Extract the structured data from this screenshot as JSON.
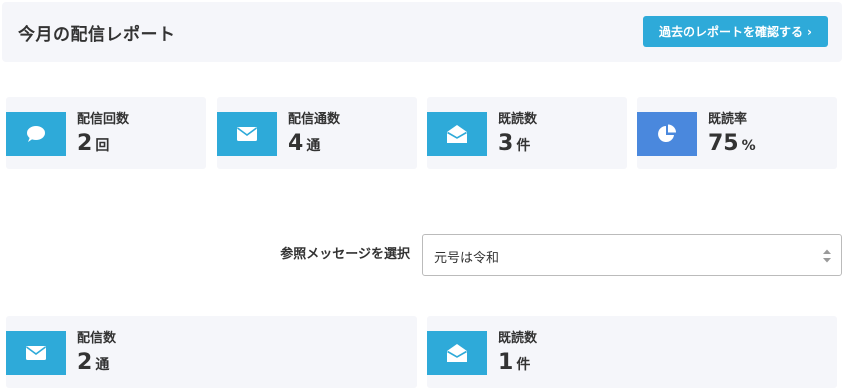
{
  "header": {
    "title": "今月の配信レポート",
    "button_label": "過去のレポートを確認する",
    "button_chevron": "›"
  },
  "stats": [
    {
      "label": "配信回数",
      "value": "2",
      "unit": "回",
      "icon": "chat-bubble-icon",
      "color": "#2eaad9"
    },
    {
      "label": "配信通数",
      "value": "4",
      "unit": "通",
      "icon": "envelope-icon",
      "color": "#2eaad9"
    },
    {
      "label": "既読数",
      "value": "3",
      "unit": "件",
      "icon": "envelope-open-icon",
      "color": "#2eaad9"
    },
    {
      "label": "既読率",
      "value": "75",
      "unit": "%",
      "icon": "pie-chart-icon",
      "color": "#4a88dd"
    }
  ],
  "message_select": {
    "label": "参照メッセージを選択",
    "selected": "元号は令和"
  },
  "message_stats": [
    {
      "label": "配信数",
      "value": "2",
      "unit": "通",
      "icon": "envelope-icon",
      "color": "#2eaad9"
    },
    {
      "label": "既読数",
      "value": "1",
      "unit": "件",
      "icon": "envelope-open-icon",
      "color": "#2eaad9"
    }
  ]
}
